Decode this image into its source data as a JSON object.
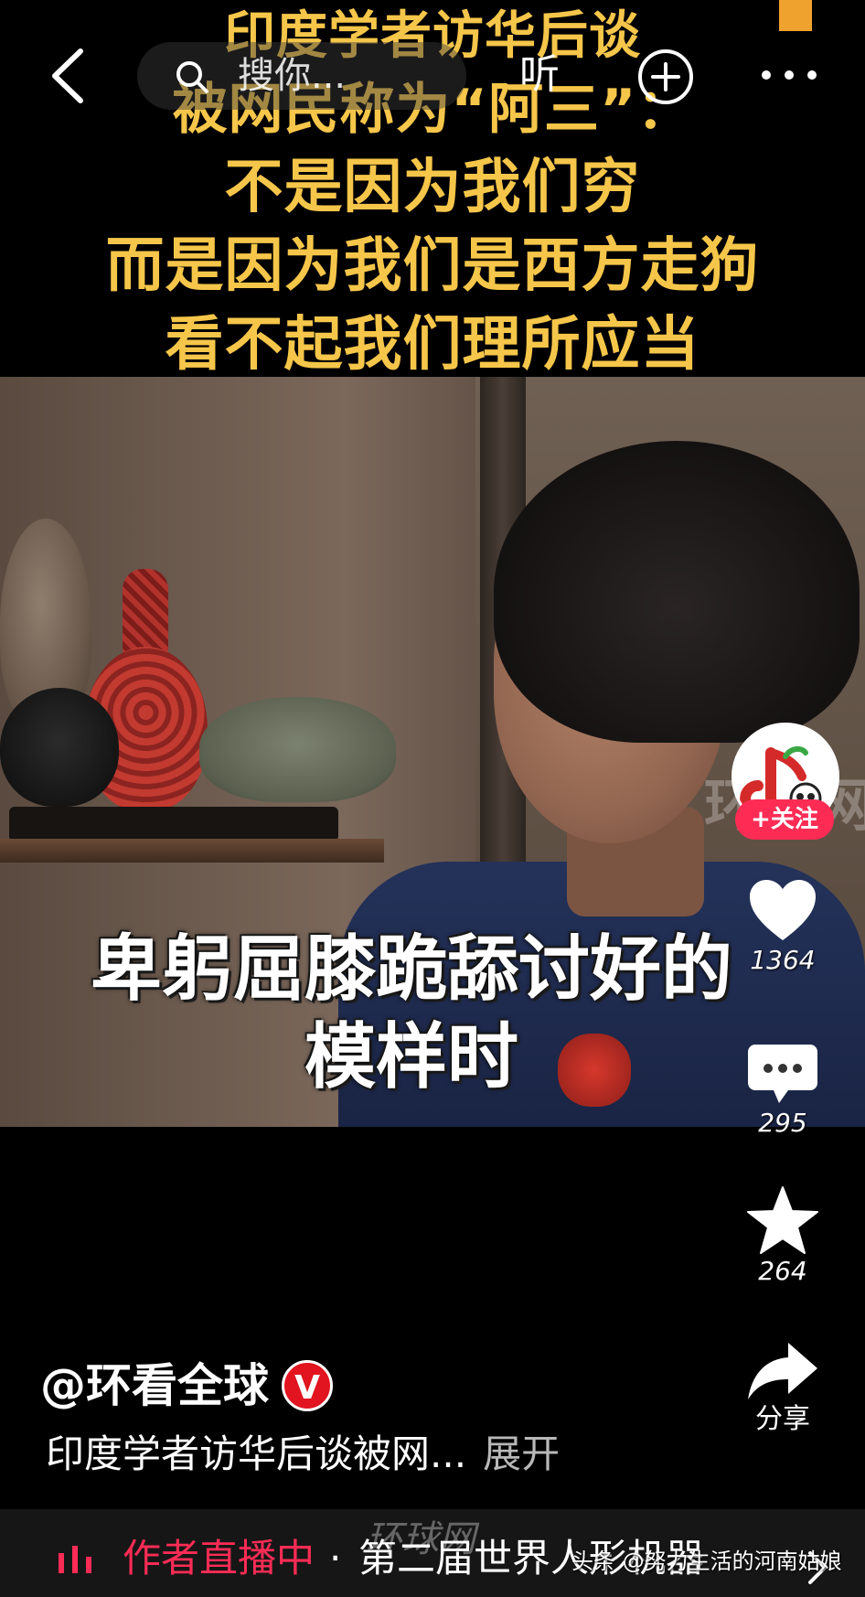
{
  "video": {
    "title_lines": [
      "印度学者访华后谈",
      "被网民称为“阿三”：",
      "不是因为我们穷",
      "而是因为我们是西方走狗",
      "看不起我们理所应当"
    ],
    "caption_lines": [
      "卑躬屈膝跪舔讨好的",
      "模样时"
    ],
    "watermark": "环球网"
  },
  "topbar": {
    "search_placeholder": "搜你...",
    "listen_label": "听",
    "back_icon": "chevron-left-icon",
    "plus_icon": "plus-circle-icon",
    "more_icon": "more-dots-icon"
  },
  "actions": {
    "follow_label": "+关注",
    "like_count": "1364",
    "comment_count": "295",
    "favorite_count": "264",
    "share_label": "分享"
  },
  "author": {
    "name": "@环看全球",
    "verified_badge": "V"
  },
  "description": {
    "text": "印度学者访华后谈被网...",
    "expand_label": "展开"
  },
  "bottombar": {
    "live_label": "作者直播中",
    "separator": "·",
    "event_text": "第二届世界人形机器",
    "watermark": "环球网"
  },
  "credit": "头条 @努力生活的河南姑娘",
  "colors": {
    "accent": "#fe2c55",
    "title_yellow": "#f6c64a",
    "verified_red": "#e1141f"
  }
}
